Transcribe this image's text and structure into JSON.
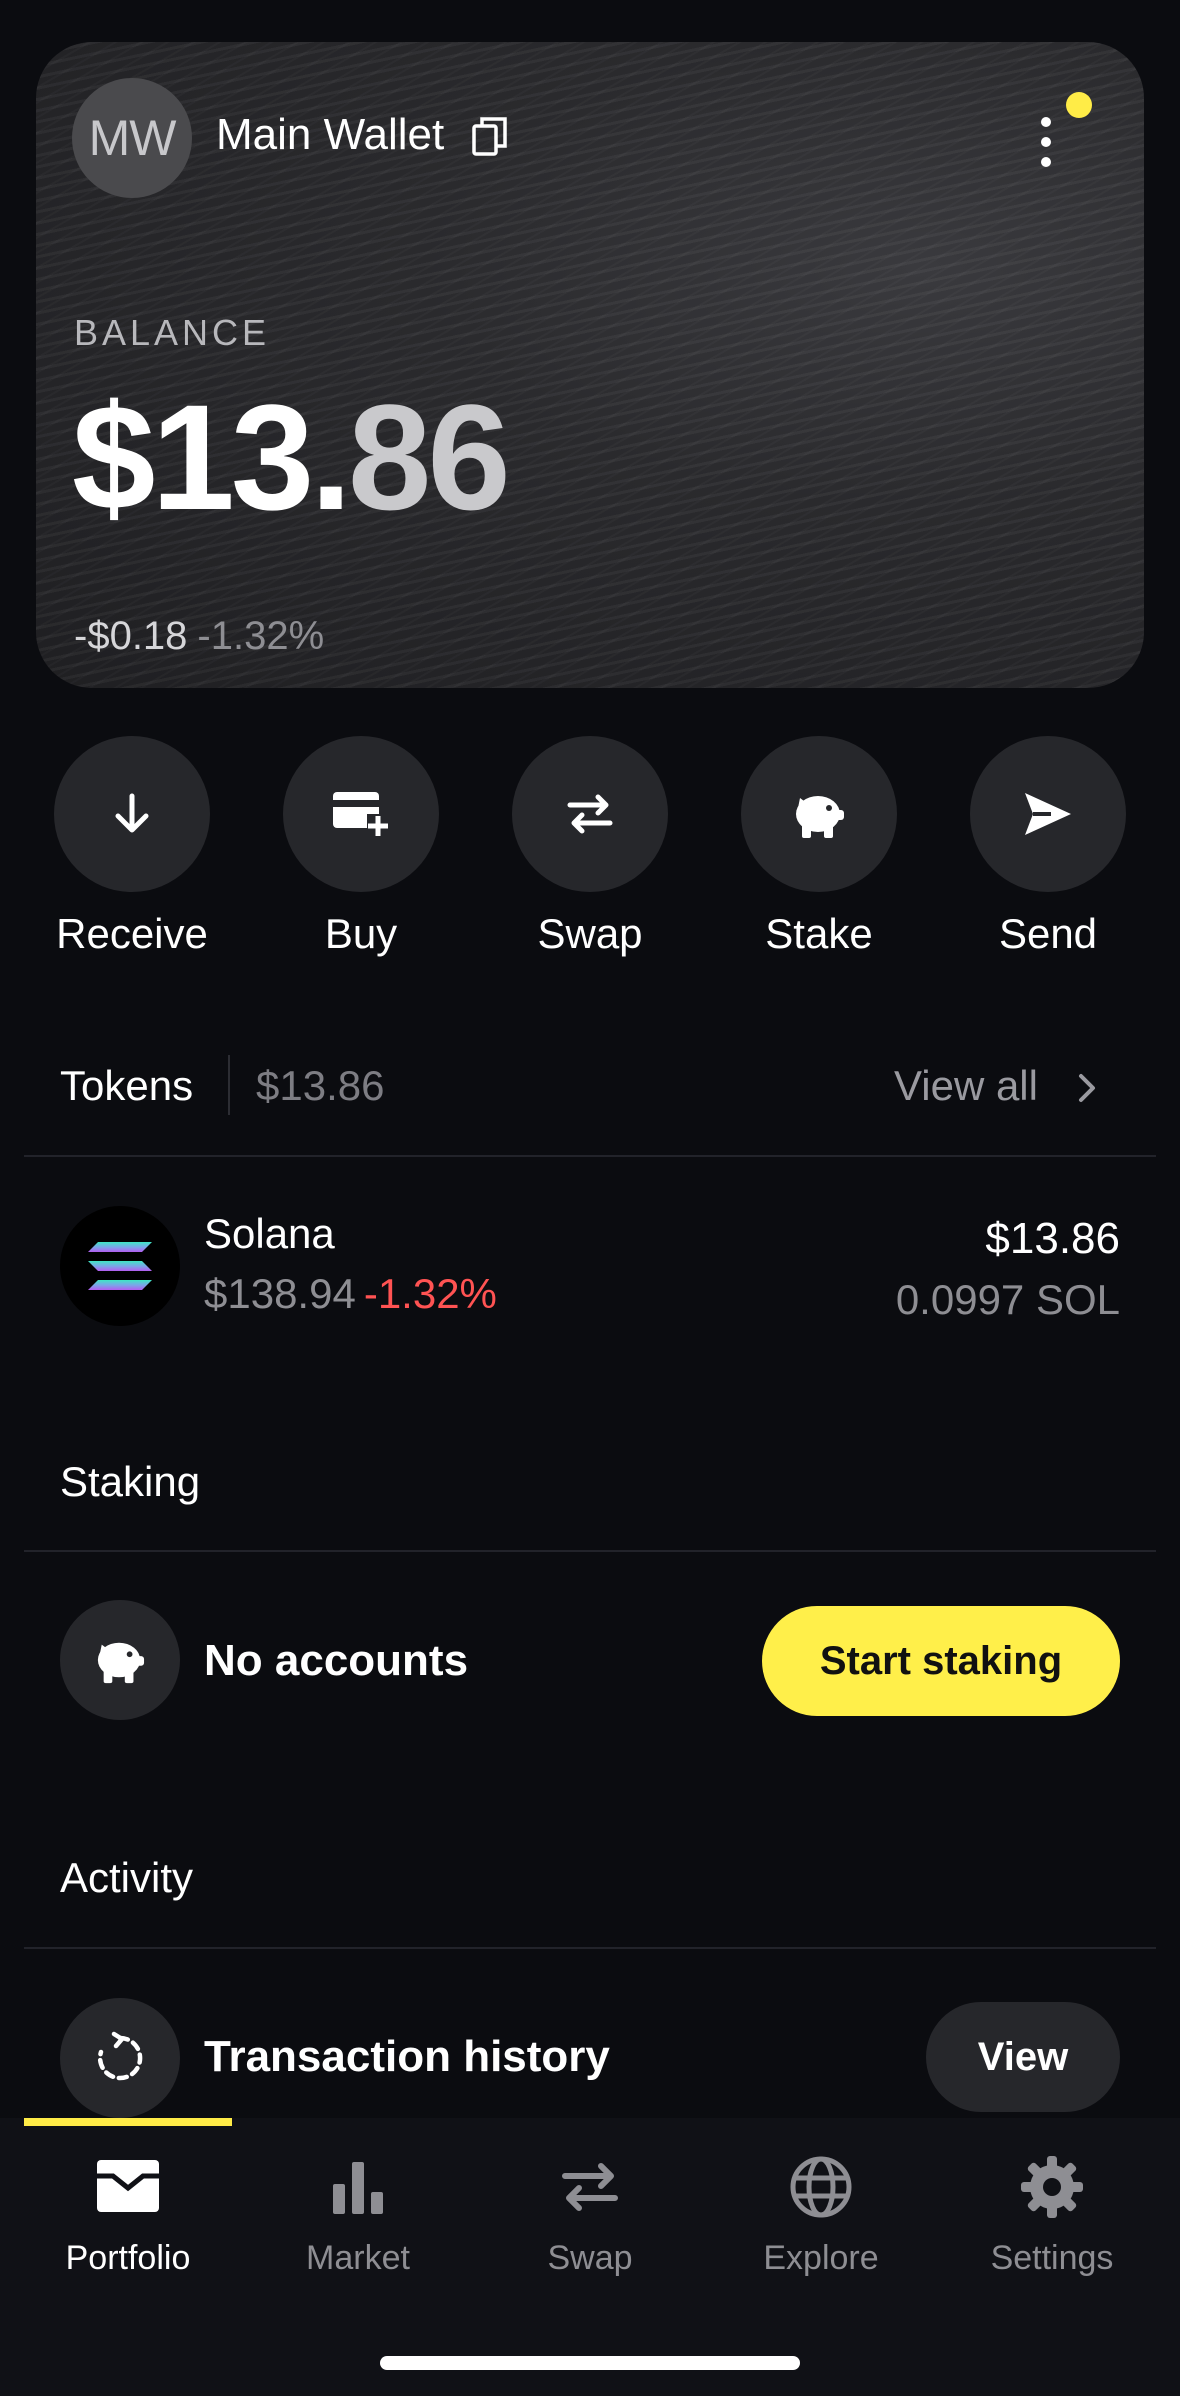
{
  "wallet": {
    "avatar_initials": "MW",
    "name": "Main Wallet",
    "balance_label": "BALANCE",
    "balance_whole": "$13.",
    "balance_cents": "86",
    "change_abs": "-$0.18",
    "change_pct": "-1.32%",
    "notification_color": "#ffec47"
  },
  "actions": [
    {
      "label": "Receive",
      "icon": "arrow-down-icon"
    },
    {
      "label": "Buy",
      "icon": "card-plus-icon"
    },
    {
      "label": "Swap",
      "icon": "swap-arrows-icon"
    },
    {
      "label": "Stake",
      "icon": "piggy-bank-icon"
    },
    {
      "label": "Send",
      "icon": "paper-plane-icon"
    }
  ],
  "tokens": {
    "title": "Tokens",
    "total": "$13.86",
    "view_all": "View all",
    "items": [
      {
        "name": "Solana",
        "price": "$138.94",
        "change": "-1.32%",
        "value": "$13.86",
        "amount": "0.0997 SOL",
        "icon": "solana-icon"
      }
    ]
  },
  "staking": {
    "title": "Staking",
    "status": "No accounts",
    "button": "Start staking",
    "accent_color": "#ffef4a"
  },
  "activity": {
    "title": "Activity",
    "row_label": "Transaction history",
    "button": "View"
  },
  "bottom_nav": {
    "active_index": 0,
    "items": [
      {
        "label": "Portfolio",
        "icon": "portfolio-icon"
      },
      {
        "label": "Market",
        "icon": "bar-chart-icon"
      },
      {
        "label": "Swap",
        "icon": "swap-arrows-icon"
      },
      {
        "label": "Explore",
        "icon": "globe-icon"
      },
      {
        "label": "Settings",
        "icon": "gear-icon"
      }
    ]
  }
}
